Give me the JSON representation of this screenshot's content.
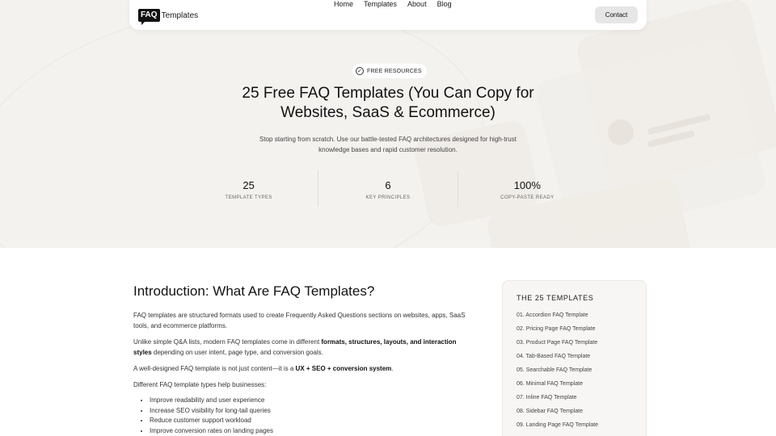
{
  "nav": {
    "logo_mark": "FAQ",
    "logo_text": "Templates",
    "links": [
      "Home",
      "Templates",
      "About",
      "Blog"
    ],
    "contact_label": "Contact"
  },
  "hero": {
    "badge_label": "FREE RESOURCES",
    "title": "25 Free FAQ Templates (You Can Copy for Websites, SaaS & Ecommerce)",
    "subtitle": "Stop starting from scratch. Use our battle-tested FAQ architectures designed for high-trust knowledge bases and rapid customer resolution.",
    "stats": [
      {
        "value": "25",
        "label": "TEMPLATE TYPES"
      },
      {
        "value": "6",
        "label": "KEY PRINCIPLES"
      },
      {
        "value": "100%",
        "label": "COPY-PASTE READY"
      }
    ]
  },
  "intro": {
    "title": "Introduction: What Are FAQ Templates?",
    "p1": "FAQ templates are structured formats used to create Frequently Asked Questions sections on websites, apps, SaaS tools, and ecommerce platforms.",
    "p2_start": "Unlike simple Q&A lists, modern FAQ templates come in different ",
    "p2_bold": "formats, structures, layouts, and interaction styles",
    "p2_end": " depending on user intent, page type, and conversion goals.",
    "p3_start": "A well-designed FAQ template is not just content—it is a ",
    "p3_bold": "UX + SEO + conversion system",
    "p3_end": ".",
    "p4": "Different FAQ template types help businesses:",
    "bullets": [
      "Improve readability and user experience",
      "Increase SEO visibility for long-tail queries",
      "Reduce customer support workload",
      "Improve conversion rates on landing pages"
    ]
  },
  "toc": {
    "title": "THE 25 TEMPLATES",
    "items": [
      "01. Accordion FAQ Template",
      "02. Pricing Page FAQ Template",
      "03. Product Page FAQ Template",
      "04. Tab-Based FAQ Template",
      "05. Searchable FAQ Template",
      "06. Minimal FAQ Template",
      "07. Inline FAQ Template",
      "08. Sidebar FAQ Template",
      "09. Landing Page FAQ Template"
    ]
  }
}
